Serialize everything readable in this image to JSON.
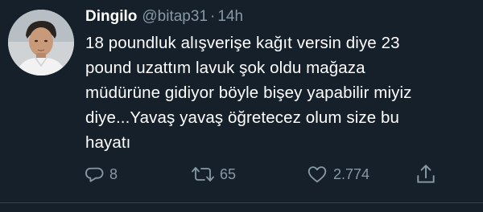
{
  "tweet": {
    "author_name": "Dingilo",
    "handle": "@bitap31",
    "separator": "·",
    "time": "14h",
    "text": "18 poundluk alışverişe kağıt versin diye 23\npound uzattım lavuk şok oldu mağaza\nmüdürüne gidiyor böyle bişey yapabilir miyiz\ndiye...Yavaş yavaş öğretecez olum size bu\nhayatı"
  },
  "actions": {
    "reply_count": "8",
    "retweet_count": "65",
    "like_count": "2.774"
  },
  "icons": {
    "reply": "reply-icon",
    "retweet": "retweet-icon",
    "like": "heart-icon",
    "share": "share-icon"
  },
  "colors": {
    "background": "#15202b",
    "muted": "#8899a6",
    "text": "#ffffff"
  }
}
